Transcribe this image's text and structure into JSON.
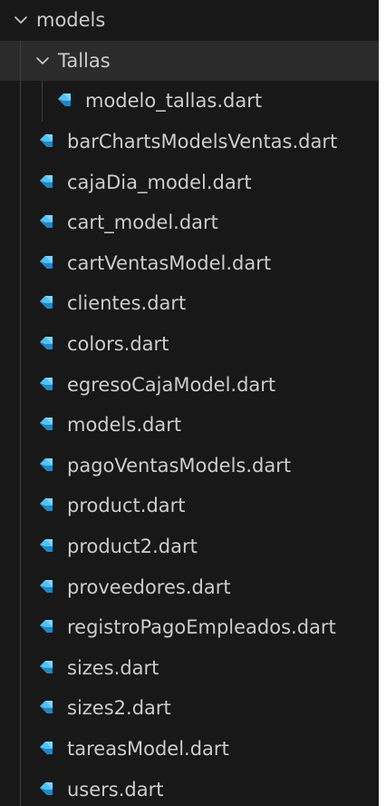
{
  "explorer": {
    "root_folder": {
      "name": "models",
      "expanded": true
    },
    "sub_folder": {
      "name": "Tallas",
      "expanded": true
    },
    "sub_files": [
      {
        "name": "modelo_tallas.dart",
        "icon": "dart-icon"
      }
    ],
    "files": [
      {
        "name": "barChartsModelsVentas.dart",
        "icon": "dart-icon"
      },
      {
        "name": "cajaDia_model.dart",
        "icon": "dart-icon"
      },
      {
        "name": "cart_model.dart",
        "icon": "dart-icon"
      },
      {
        "name": "cartVentasModel.dart",
        "icon": "dart-icon"
      },
      {
        "name": "clientes.dart",
        "icon": "dart-icon"
      },
      {
        "name": "colors.dart",
        "icon": "dart-icon"
      },
      {
        "name": "egresoCajaModel.dart",
        "icon": "dart-icon"
      },
      {
        "name": "models.dart",
        "icon": "dart-icon"
      },
      {
        "name": "pagoVentasModels.dart",
        "icon": "dart-icon"
      },
      {
        "name": "product.dart",
        "icon": "dart-icon"
      },
      {
        "name": "product2.dart",
        "icon": "dart-icon"
      },
      {
        "name": "proveedores.dart",
        "icon": "dart-icon"
      },
      {
        "name": "registroPagoEmpleados.dart",
        "icon": "dart-icon"
      },
      {
        "name": "sizes.dart",
        "icon": "dart-icon"
      },
      {
        "name": "sizes2.dart",
        "icon": "dart-icon"
      },
      {
        "name": "tareasModel.dart",
        "icon": "dart-icon"
      },
      {
        "name": "users.dart",
        "icon": "dart-icon"
      }
    ],
    "colors": {
      "background": "#181818",
      "selected_row": "#2b2b2b",
      "text": "#cccccc",
      "dart_blue": "#4fc3f7",
      "dart_dark": "#1e88c9"
    }
  }
}
